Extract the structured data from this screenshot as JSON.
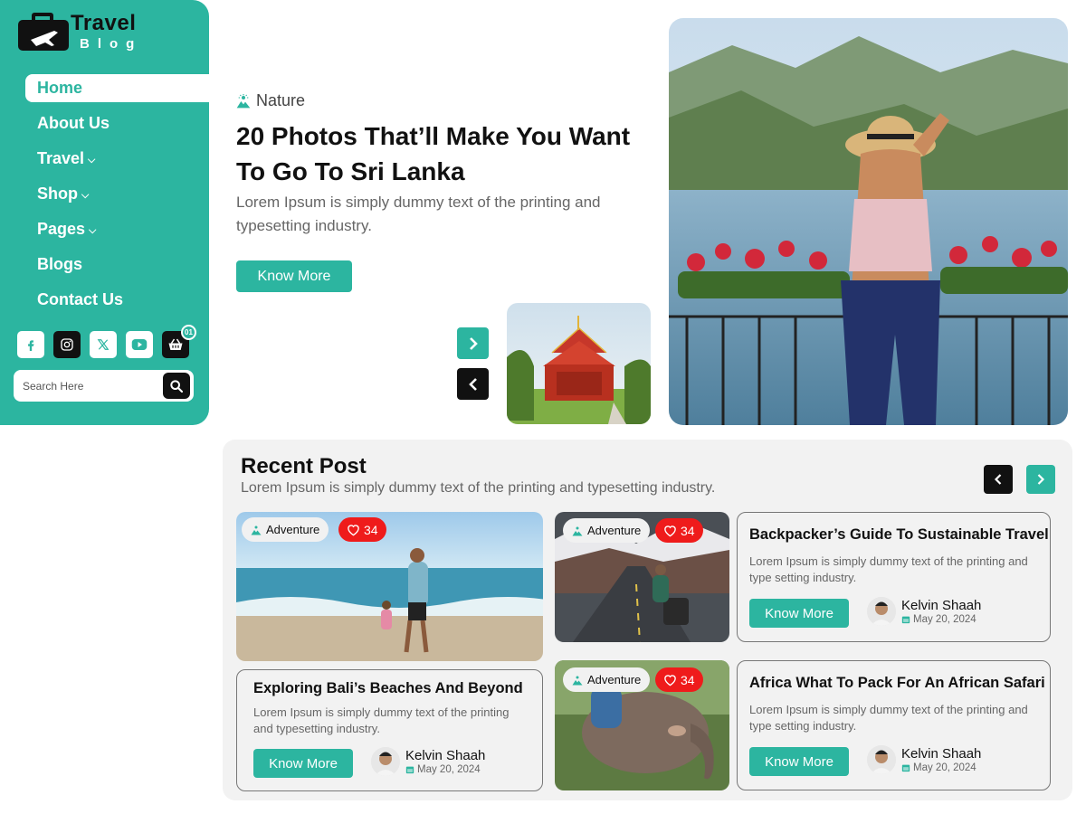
{
  "brand": {
    "word1": "Travel",
    "word2": "Blog"
  },
  "nav": {
    "items": [
      {
        "label": "Home",
        "has_dropdown": false,
        "active": true
      },
      {
        "label": "About Us",
        "has_dropdown": false
      },
      {
        "label": "Travel",
        "has_dropdown": true
      },
      {
        "label": "Shop",
        "has_dropdown": true
      },
      {
        "label": "Pages",
        "has_dropdown": true
      },
      {
        "label": "Blogs",
        "has_dropdown": false
      },
      {
        "label": "Contact Us",
        "has_dropdown": false
      }
    ]
  },
  "socials": [
    {
      "name": "facebook-icon"
    },
    {
      "name": "instagram-icon"
    },
    {
      "name": "x-icon"
    },
    {
      "name": "youtube-icon"
    },
    {
      "name": "basket-icon"
    }
  ],
  "cart": {
    "count": "01"
  },
  "search": {
    "placeholder": "Search Here"
  },
  "hero": {
    "category": "Nature",
    "title": "20 Photos That’ll Make You Want To Go To Sri Lanka",
    "description": "Lorem Ipsum is simply dummy text of the printing and typesetting industry.",
    "button": "Know More"
  },
  "recent": {
    "title": "Recent Post",
    "subtitle": "Lorem Ipsum is simply dummy text of the printing and typesetting industry."
  },
  "posts": [
    {
      "tag": "Adventure",
      "likes": "34",
      "title": "Exploring Bali’s Beaches And Beyond",
      "description": "Lorem Ipsum is simply dummy text of the printing and typesetting industry.",
      "button": "Know More",
      "author": "Kelvin Shaah",
      "date": "May 20, 2024"
    },
    {
      "tag": "Adventure",
      "likes": "34",
      "title": "Backpacker’s Guide To Sustainable Travel",
      "description": "Lorem Ipsum is simply dummy text of the printing and type setting industry.",
      "button": "Know More",
      "author": "Kelvin Shaah",
      "date": "May 20, 2024"
    },
    {
      "tag": "Adventure",
      "likes": "34",
      "title": "Africa What To Pack For An African Safari",
      "description": "Lorem Ipsum is simply dummy text of the printing and type setting industry.",
      "button": "Know More",
      "author": "Kelvin Shaah",
      "date": "May 20, 2024"
    }
  ],
  "colors": {
    "accent": "#2cb5a0",
    "dark": "#111111",
    "like": "#ef1b1b",
    "panel": "#f2f2f2"
  }
}
